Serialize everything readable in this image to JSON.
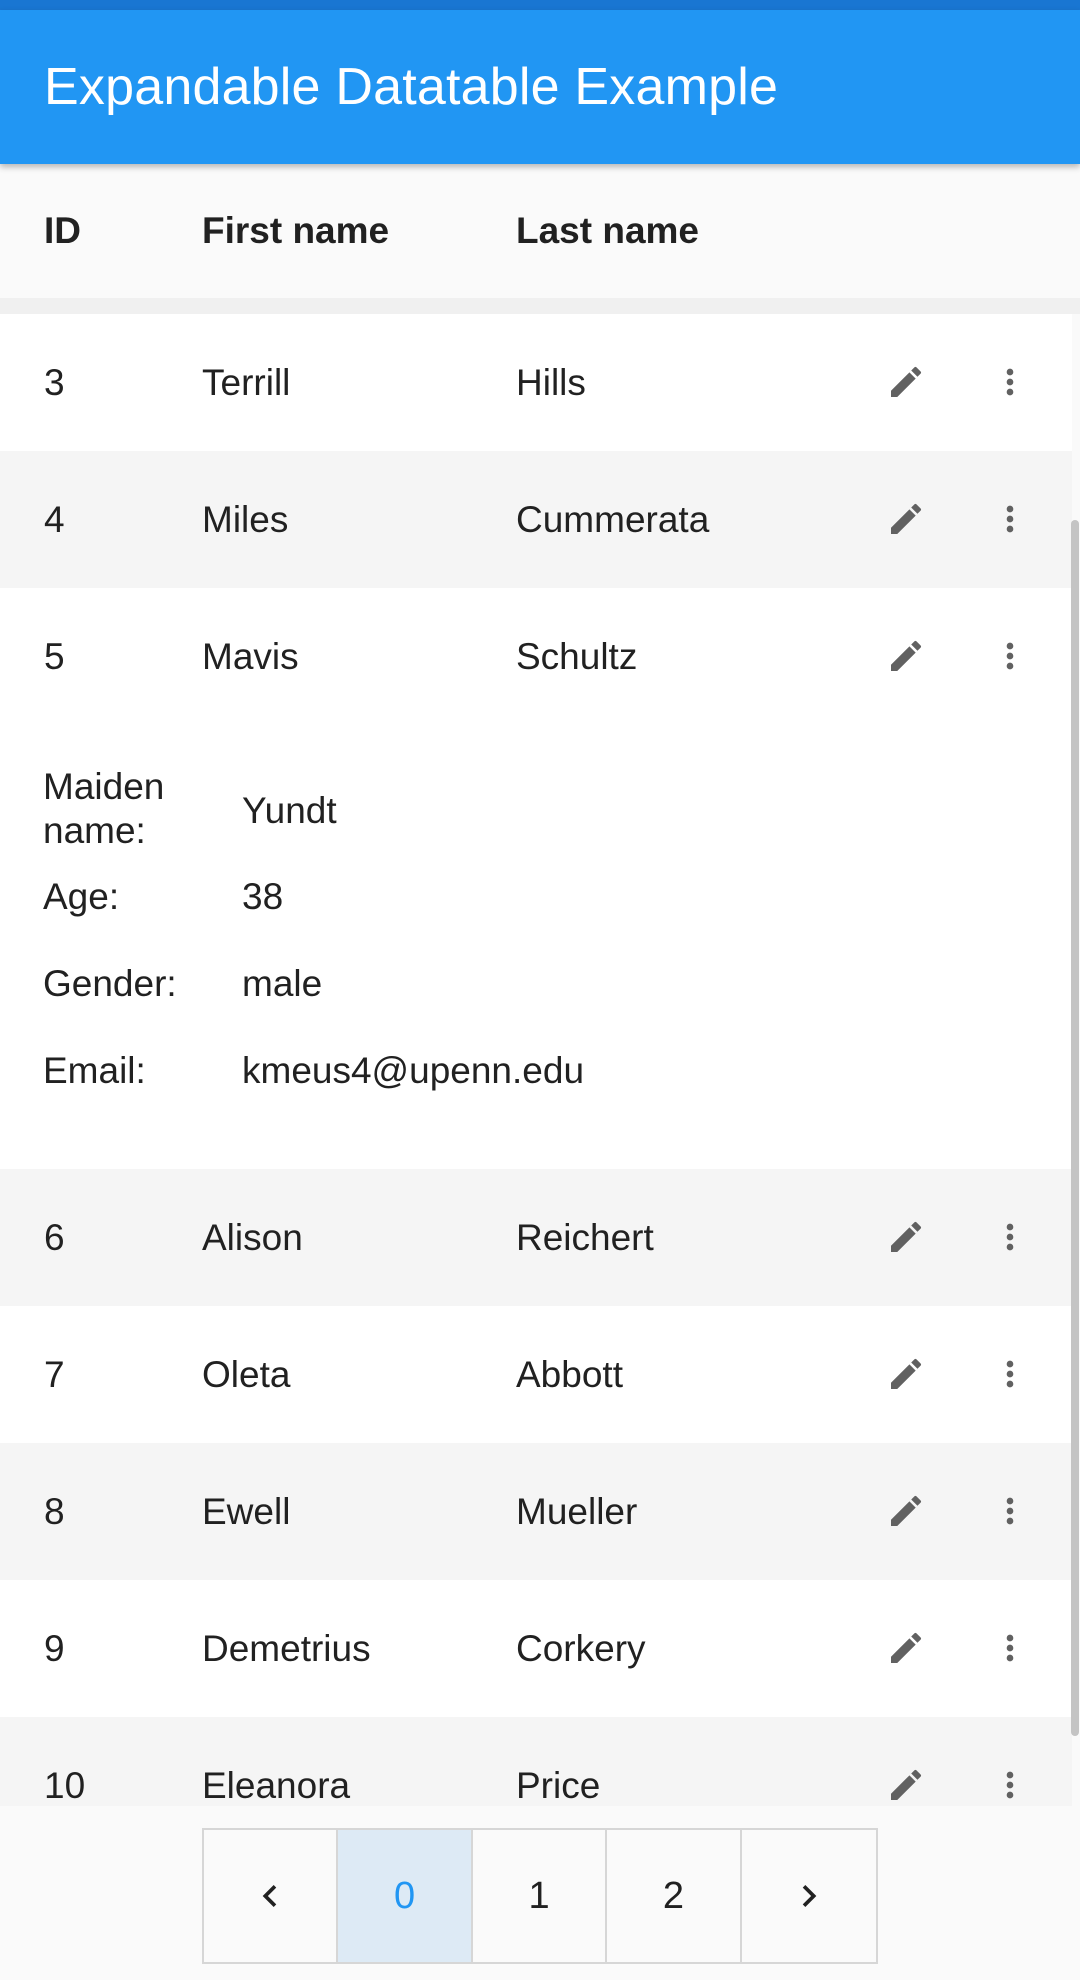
{
  "app": {
    "title": "Expandable Datatable Example"
  },
  "table": {
    "headers": {
      "id": "ID",
      "first": "First name",
      "last": "Last name"
    },
    "rows": [
      {
        "id": "3",
        "first": "Terrill",
        "last": "Hills"
      },
      {
        "id": "4",
        "first": "Miles",
        "last": "Cummerata"
      },
      {
        "id": "5",
        "first": "Mavis",
        "last": "Schultz"
      },
      {
        "id": "6",
        "first": "Alison",
        "last": "Reichert"
      },
      {
        "id": "7",
        "first": "Oleta",
        "last": "Abbott"
      },
      {
        "id": "8",
        "first": "Ewell",
        "last": "Mueller"
      },
      {
        "id": "9",
        "first": "Demetrius",
        "last": "Corkery"
      },
      {
        "id": "10",
        "first": "Eleanora",
        "last": "Price"
      }
    ],
    "expanded": {
      "maiden_label_1": "Maiden",
      "maiden_label_2": "name:",
      "maiden_value": "Yundt",
      "age_label": "Age:",
      "age_value": "38",
      "gender_label": "Gender:",
      "gender_value": "male",
      "email_label": "Email:",
      "email_value": "kmeus4@upenn.edu"
    },
    "row_icons": {
      "edit": "pencil-icon",
      "more": "more-vert-icon"
    }
  },
  "pagination": {
    "prev_icon": "chevron-left-icon",
    "next_icon": "chevron-right-icon",
    "pages": [
      "0",
      "1",
      "2"
    ],
    "active_page": "0"
  },
  "colors": {
    "primary": "#2196f3",
    "status": "#1976d2",
    "active_page_bg": "#ddeaf5",
    "icon": "#616161"
  }
}
